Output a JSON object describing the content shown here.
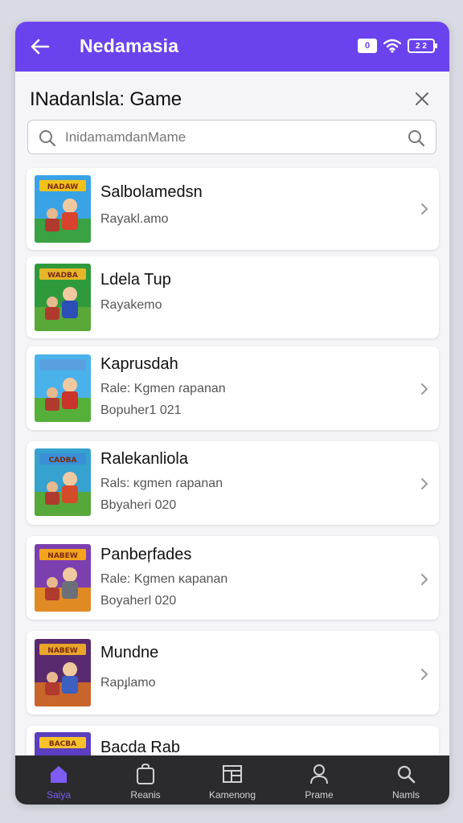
{
  "appbar": {
    "title": "Nedamasia",
    "sim_label": "0",
    "battery_label": "2 2"
  },
  "sheet": {
    "title": "INadanlsla: Game"
  },
  "search": {
    "placeholder": "InidamamdanMame"
  },
  "games": [
    {
      "name": "Salbolamedsn",
      "line1": "Rayakl.amo",
      "line2": "",
      "chevron": true
    },
    {
      "name": "Ldela Tup",
      "line1": "Rayakemo",
      "line2": "",
      "chevron": false
    },
    {
      "name": "Kaprusdah",
      "line1": "Rale: Kgmen ɾapanan",
      "line2": "Bopuher1 021",
      "chevron": true
    },
    {
      "name": "Ralekanliola",
      "line1": "Rals: κgmen ɾapanan",
      "line2": "Bbyaheri 020",
      "chevron": true
    },
    {
      "name": "Panbeŗfades",
      "line1": "Rale: Kgmen ĸapanan",
      "line2": "Boyaherl 020",
      "chevron": true
    },
    {
      "name": "Mundne",
      "line1": "Rapɟlamo",
      "line2": "",
      "chevron": true
    },
    {
      "name": "Bacda Rab",
      "line1": "",
      "line2": "",
      "chevron": false
    }
  ],
  "thumb_themes": [
    {
      "sky": "#3aa3e6",
      "ground": "#3aa243",
      "banner": "#f2c21a",
      "hero": "#d8422e",
      "banner_text": "NADAW"
    },
    {
      "sky": "#2f9a3c",
      "ground": "#5aa938",
      "banner": "#e6b52a",
      "hero": "#2b4fb7",
      "banner_text": "WADBA"
    },
    {
      "sky": "#4ab2ea",
      "ground": "#55b03a",
      "banner": "#5aa0e0",
      "hero": "#c9332a",
      "banner_text": ""
    },
    {
      "sky": "#36a2cf",
      "ground": "#57a83b",
      "banner": "#3b8fd6",
      "hero": "#d44b2a",
      "banner_text": "CADBA"
    },
    {
      "sky": "#7b3fb0",
      "ground": "#e08a24",
      "banner": "#f4a31e",
      "hero": "#6c6f78",
      "banner_text": "NABEW"
    },
    {
      "sky": "#5a2a6e",
      "ground": "#c8652a",
      "banner": "#e8a52a",
      "hero": "#3c5fc0",
      "banner_text": "NABEW"
    },
    {
      "sky": "#5b3fc0",
      "ground": "#2c8ed6",
      "banner": "#f5c22a",
      "hero": "#e05a2e",
      "banner_text": "BACBA"
    }
  ],
  "bottomnav": [
    {
      "label": "Saiya",
      "icon": "home-icon",
      "active": true
    },
    {
      "label": "Reanis",
      "icon": "bag-icon",
      "active": false
    },
    {
      "label": "Kamenong",
      "icon": "grid-panel-icon",
      "active": false
    },
    {
      "label": "Prame",
      "icon": "person-icon",
      "active": false
    },
    {
      "label": "Namls",
      "icon": "search-icon",
      "active": false
    }
  ],
  "colors": {
    "accent": "#6a43ee",
    "nav_bg": "#2b2b2d",
    "nav_active": "#7d5cf4"
  }
}
